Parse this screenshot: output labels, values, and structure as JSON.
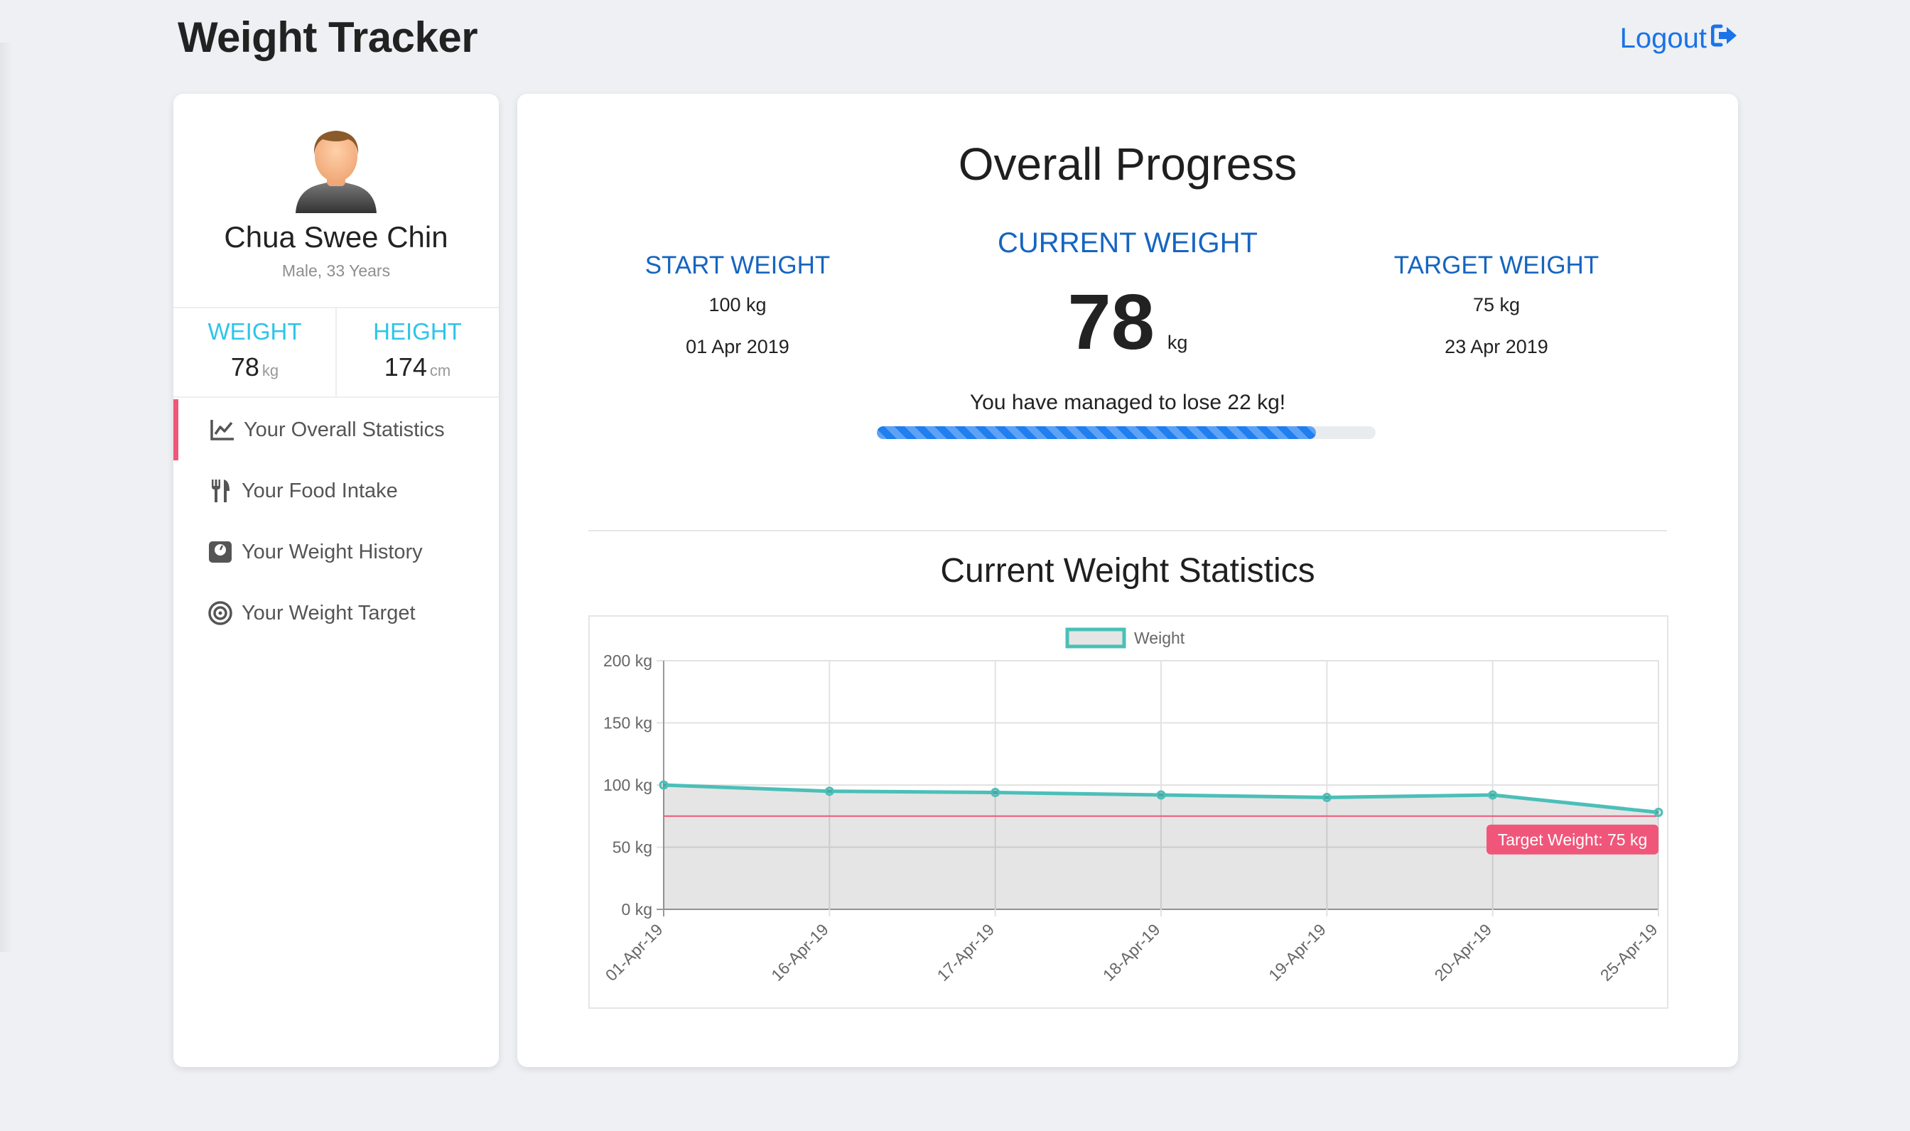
{
  "header": {
    "title": "Weight Tracker",
    "logout_label": "Logout"
  },
  "profile": {
    "name": "Chua Swee Chin",
    "subtitle": "Male, 33 Years",
    "weight_label": "WEIGHT",
    "weight_value": "78",
    "weight_unit": "kg",
    "height_label": "HEIGHT",
    "height_value": "174",
    "height_unit": "cm"
  },
  "nav": {
    "items": [
      {
        "label": "Your Overall Statistics",
        "icon": "line-chart-icon",
        "active": true
      },
      {
        "label": "Your Food Intake",
        "icon": "utensils-icon",
        "active": false
      },
      {
        "label": "Your Weight History",
        "icon": "scale-icon",
        "active": false
      },
      {
        "label": "Your Weight Target",
        "icon": "target-icon",
        "active": false
      }
    ]
  },
  "progress": {
    "title": "Overall Progress",
    "start_label": "START WEIGHT",
    "start_weight": "100 kg",
    "start_date": "01 Apr 2019",
    "current_label": "CURRENT WEIGHT",
    "current_weight": "78",
    "current_unit": "kg",
    "target_label": "TARGET WEIGHT",
    "target_weight": "75 kg",
    "target_date": "23 Apr 2019",
    "message": "You have managed to lose 22 kg!",
    "progress_fraction": 0.88
  },
  "stats_title": "Current Weight Statistics",
  "colors": {
    "accent_blue": "#1565c0",
    "stat_cyan": "#2ec5e8",
    "active_pink": "#f0567a",
    "line_teal": "#4bbfb8",
    "target_red": "#f0567a"
  },
  "chart_data": {
    "type": "area",
    "categories": [
      "01-Apr-19",
      "16-Apr-19",
      "17-Apr-19",
      "18-Apr-19",
      "19-Apr-19",
      "20-Apr-19",
      "25-Apr-19"
    ],
    "series": [
      {
        "name": "Weight",
        "values": [
          100,
          95,
          94,
          92,
          90,
          92,
          78
        ]
      }
    ],
    "yticks": [
      "0 kg",
      "50 kg",
      "100 kg",
      "150 kg",
      "200 kg"
    ],
    "ylim": [
      0,
      200
    ],
    "target_value": 75,
    "target_label": "Target Weight: 75 kg",
    "legend": "top-center",
    "grid": true
  }
}
